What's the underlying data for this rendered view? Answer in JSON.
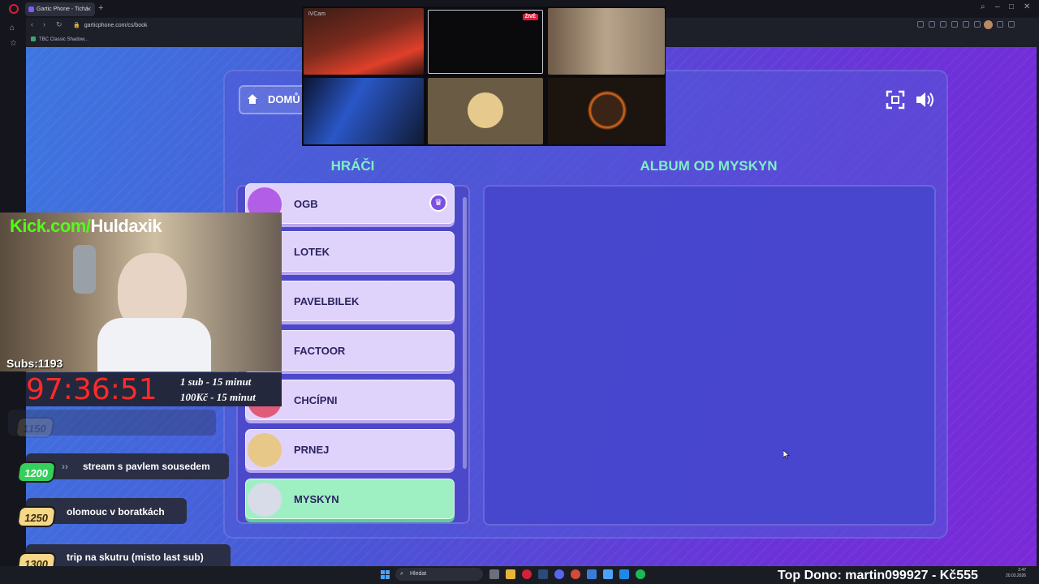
{
  "browser": {
    "tab_title": "Gartic Phone - Tichá",
    "url": "garticphone.com/cs/book",
    "bookmark": "TBC Classic Shadow..."
  },
  "game": {
    "home_label": "DOMŮ",
    "players_heading": "HRÁČI",
    "album_heading": "ALBUM OD MYSKYN",
    "players": [
      {
        "name": "OGB",
        "host": true
      },
      {
        "name": "LOTEK"
      },
      {
        "name": "PAVELBILEK"
      },
      {
        "name": "FACTOOR"
      },
      {
        "name": "CHCÍPNI"
      },
      {
        "name": "PRNEJ"
      },
      {
        "name": "MYSKYN",
        "highlight": true
      }
    ]
  },
  "cams": {
    "label": "iVCam",
    "live_badge": "ŽIVĚ"
  },
  "overlay": {
    "kick_prefix": "Kick.com/",
    "kick_user": "Huldaxik",
    "subs": "Subs:1193",
    "timer": "97:36:51",
    "rate_sub": "1 sub - 15 minut",
    "rate_money": "100Kč - 15 minut",
    "goals": [
      {
        "amount": "1150",
        "text": ""
      },
      {
        "amount": "1200",
        "text": "stream s pavlem sousedem"
      },
      {
        "amount": "1250",
        "text": "olomouc v boratkách"
      },
      {
        "amount": "1300",
        "text": "trip na skutru (misto last sub)"
      }
    ],
    "top_donor": "Top Dono: martin099927 - Kč555"
  },
  "taskbar": {
    "search_placeholder": "Hledat",
    "time": "2:47",
    "date": "20.03.2026"
  },
  "colors": {
    "accent_heading": "#7ef0c4",
    "timer_red": "#ff2a2a",
    "kick_green": "#53fc18"
  }
}
